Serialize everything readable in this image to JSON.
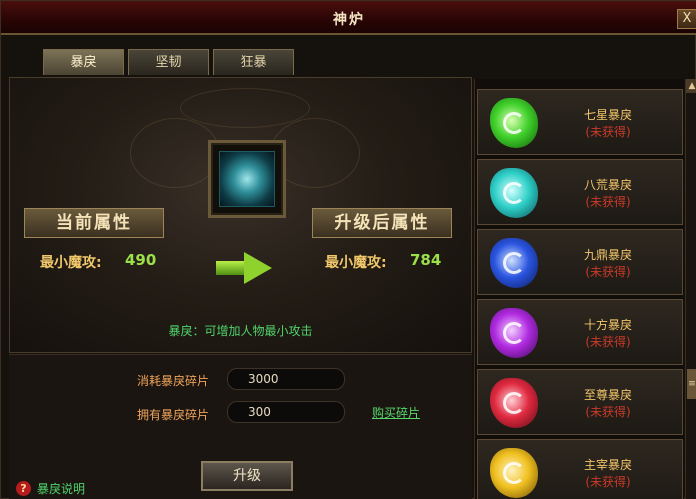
{
  "window": {
    "title": "神炉",
    "close_label": "X"
  },
  "tabs": [
    {
      "label": "暴戾",
      "active": true
    },
    {
      "label": "坚韧",
      "active": false
    },
    {
      "label": "狂暴",
      "active": false
    }
  ],
  "main": {
    "current_banner": "当前属性",
    "upgraded_banner": "升级后属性",
    "current_stat_label": "最小魔攻:",
    "current_stat_value": "490",
    "upgraded_stat_label": "最小魔攻:",
    "upgraded_stat_value": "784",
    "description": "暴戾：可增加人物最小攻击"
  },
  "lower": {
    "consume_label": "消耗暴戾碎片",
    "consume_value": "3000",
    "own_label": "拥有暴戾碎片",
    "own_value": "300",
    "buy_link": "购买碎片",
    "upgrade_button": "升级"
  },
  "help": {
    "icon": "?",
    "label": "暴戾说明"
  },
  "list": [
    {
      "name": "七星暴戾",
      "status": "(未获得)",
      "color": "#3fd02a"
    },
    {
      "name": "八荒暴戾",
      "status": "(未获得)",
      "color": "#2fd0c8"
    },
    {
      "name": "九鼎暴戾",
      "status": "(未获得)",
      "color": "#2a55e0"
    },
    {
      "name": "十方暴戾",
      "status": "(未获得)",
      "color": "#b02ae0"
    },
    {
      "name": "至尊暴戾",
      "status": "(未获得)",
      "color": "#e02a40"
    },
    {
      "name": "主宰暴戾",
      "status": "(未获得)",
      "color": "#f0c020"
    }
  ],
  "scrollbar": {
    "up_arrow": "▲",
    "thumb_glyph": "≡"
  },
  "colors": {
    "accent_gold": "#f0c76a",
    "value_green": "#9be04a",
    "status_red": "#c93a2a",
    "link_green": "#55d86a"
  }
}
